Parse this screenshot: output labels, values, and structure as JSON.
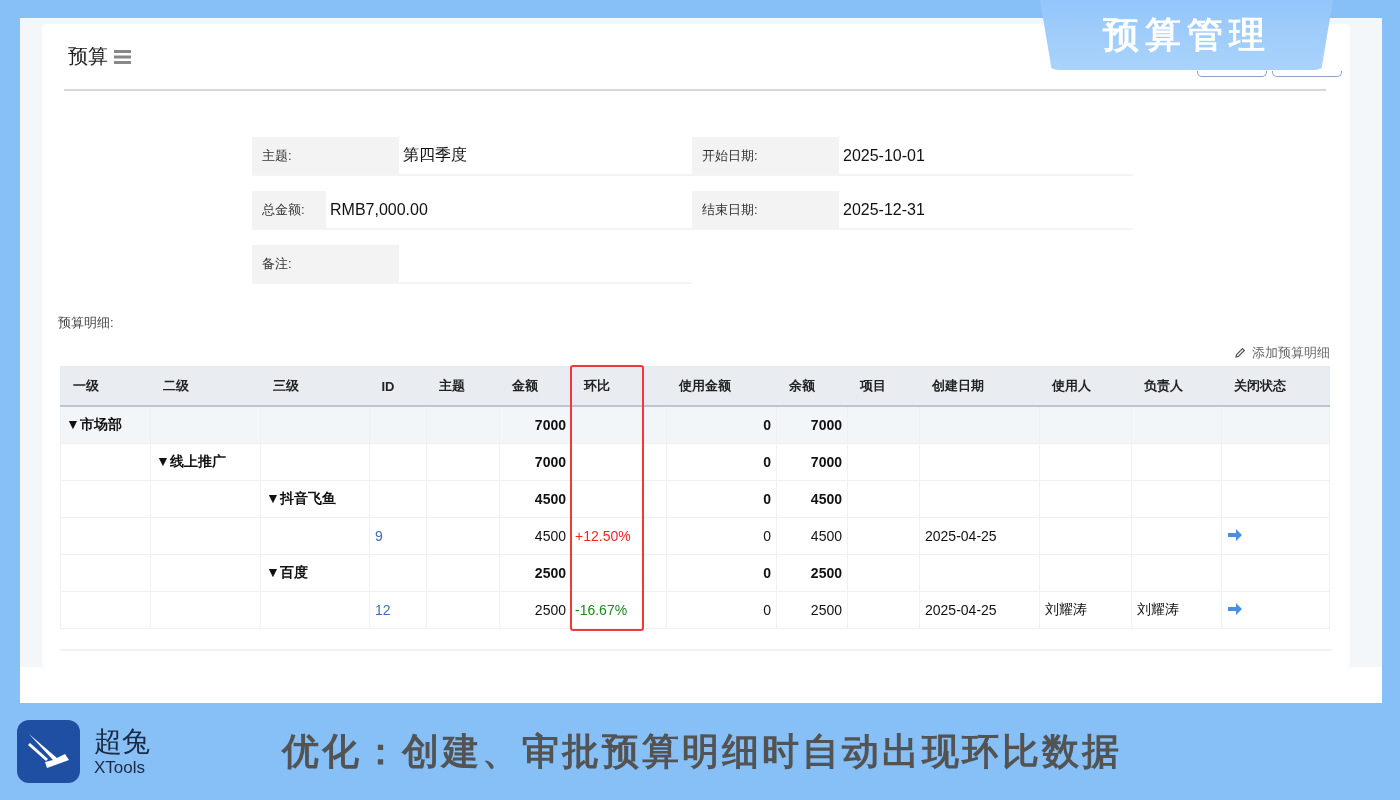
{
  "banner": {
    "title": "预算管理"
  },
  "page": {
    "title": "预算"
  },
  "form": {
    "fields": [
      {
        "label": "主题:",
        "value": "第四季度"
      },
      {
        "label": "开始日期:",
        "value": "2025-10-01"
      },
      {
        "label": "总金额:",
        "value": "RMB7,000.00",
        "compact": true
      },
      {
        "label": "结束日期:",
        "value": "2025-12-31"
      },
      {
        "label": "备注:"
      }
    ]
  },
  "detail": {
    "title": "预算明细:",
    "add_link": "添加预算明细",
    "columns": [
      "一级",
      "二级",
      "三级",
      "ID",
      "主题",
      "金额",
      "环比",
      "使用金额",
      "余额",
      "项目",
      "创建日期",
      "使用人",
      "负责人",
      "关闭状态"
    ],
    "rows": [
      {
        "label": "▼市场部",
        "amount": "7000",
        "used": "0",
        "balance": "7000",
        "children": [
          {
            "label": "▼线上推广",
            "amount": "7000",
            "used": "0",
            "balance": "7000",
            "children": [
              {
                "label": "▼抖音飞鱼",
                "amount": "4500",
                "used": "0",
                "balance": "4500",
                "children": [
                  {
                    "kind": "item",
                    "id": "9",
                    "amount": "4500",
                    "ratio": "+12.50%",
                    "color": "#ff2222",
                    "used": "0",
                    "balance": "4500",
                    "date": "2025-04-25"
                  }
                ]
              },
              {
                "label": "▼百度",
                "amount": "2500",
                "used": "0",
                "balance": "2500",
                "children": [
                  {
                    "kind": "item",
                    "id": "12",
                    "amount": "2500",
                    "ratio": "-16.67%",
                    "color": "#1a8a1a",
                    "used": "0",
                    "balance": "2500",
                    "date": "2025-04-25",
                    "user": "刘耀涛",
                    "owner": "刘耀涛"
                  }
                ]
              }
            ]
          }
        ]
      }
    ]
  },
  "footer": {
    "brand": "超兔",
    "brand_sub": "XTools",
    "caption": "优化：创建、审批预算明细时自动出现环比数据"
  }
}
